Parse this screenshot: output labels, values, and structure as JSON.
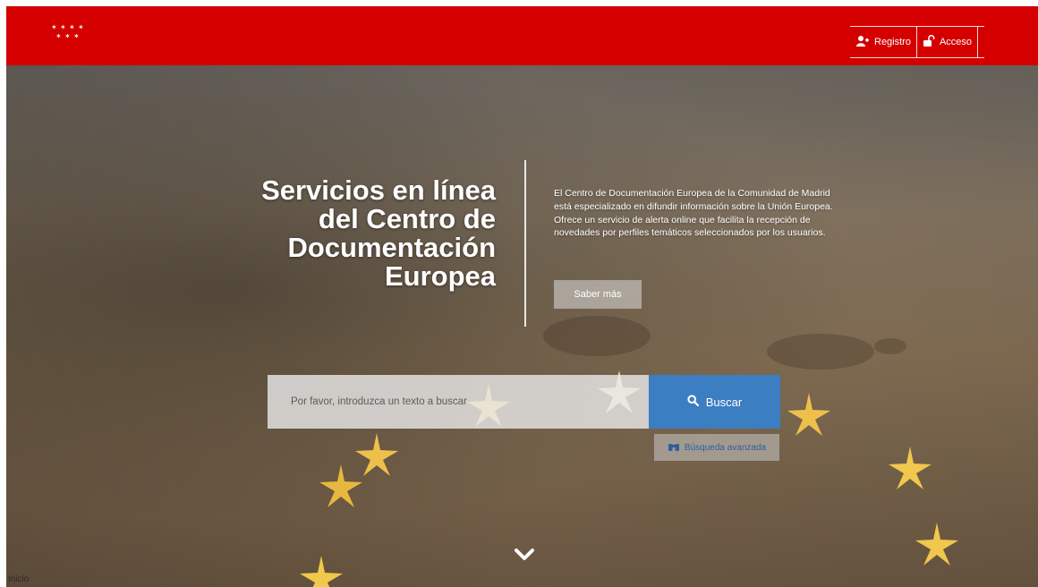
{
  "header": {
    "logo_stars": [
      "✶",
      "✶",
      "✶",
      "✶",
      "✶",
      "✶",
      "✶"
    ],
    "register_label": "Registro",
    "login_label": "Acceso",
    "icons": {
      "register": "user-plus-icon",
      "login": "unlock-icon"
    }
  },
  "hero": {
    "title_lines": [
      "Servicios en línea",
      "del Centro de",
      "Documentación",
      "Europea"
    ],
    "intro_paragraph_1": "El Centro de Documentación Europea de la Comunidad de Madrid está especializado en difundir información sobre la Unión Europea.",
    "intro_paragraph_2": "Ofrece un servicio de alerta online que facilita la recepción de novedades por perfiles temáticos seleccionados por los usuarios.",
    "more_button_label": "Saber más"
  },
  "search": {
    "placeholder": "Por favor, introduzca un texto a buscar",
    "button_label": "Buscar",
    "advanced_label": "Búsqueda avanzada",
    "icons": {
      "search": "search-icon",
      "advanced": "binoculars-icon"
    }
  },
  "navigation": {
    "scroll_icon": "chevron-down-icon"
  },
  "status_bar": {
    "text": "Inicio"
  },
  "colors": {
    "brand_red": "#d40000",
    "search_blue": "#3c7ec2",
    "white": "#ffffff"
  }
}
